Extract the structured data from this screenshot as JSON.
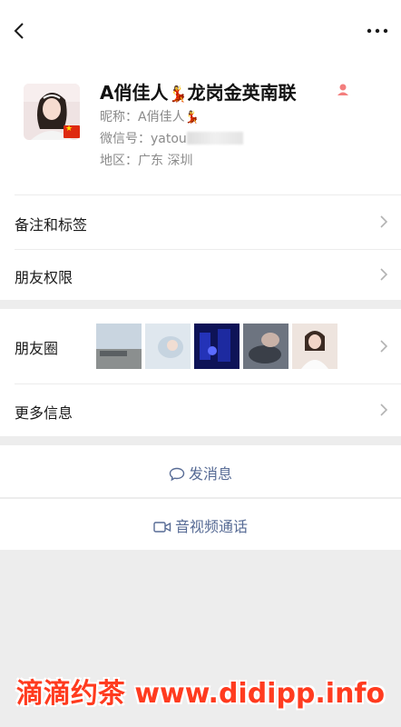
{
  "profile": {
    "name_prefix": "A俏佳人",
    "name_emoji": "💃",
    "name_suffix": "龙岗金英南联",
    "nickname_label": "昵称：",
    "nickname_value": "A俏佳人",
    "nickname_emoji": "💃",
    "wechat_id_label": "微信号：",
    "wechat_id_value": "yatou",
    "region_label": "地区：",
    "region_value": "广东  深圳",
    "gender_icon": "female-icon",
    "flag_icon": "china-flag-icon"
  },
  "rows": {
    "remarks_label": "备注和标签",
    "permissions_label": "朋友权限",
    "moments_label": "朋友圈",
    "more_info_label": "更多信息"
  },
  "actions": {
    "message_label": "发消息",
    "call_label": "音视频通话"
  },
  "watermark": {
    "text": "滴滴约茶 www.didipp.info"
  },
  "colors": {
    "accent_link": "#576b95",
    "watermark": "#ff3b1f",
    "background": "#ededed"
  }
}
